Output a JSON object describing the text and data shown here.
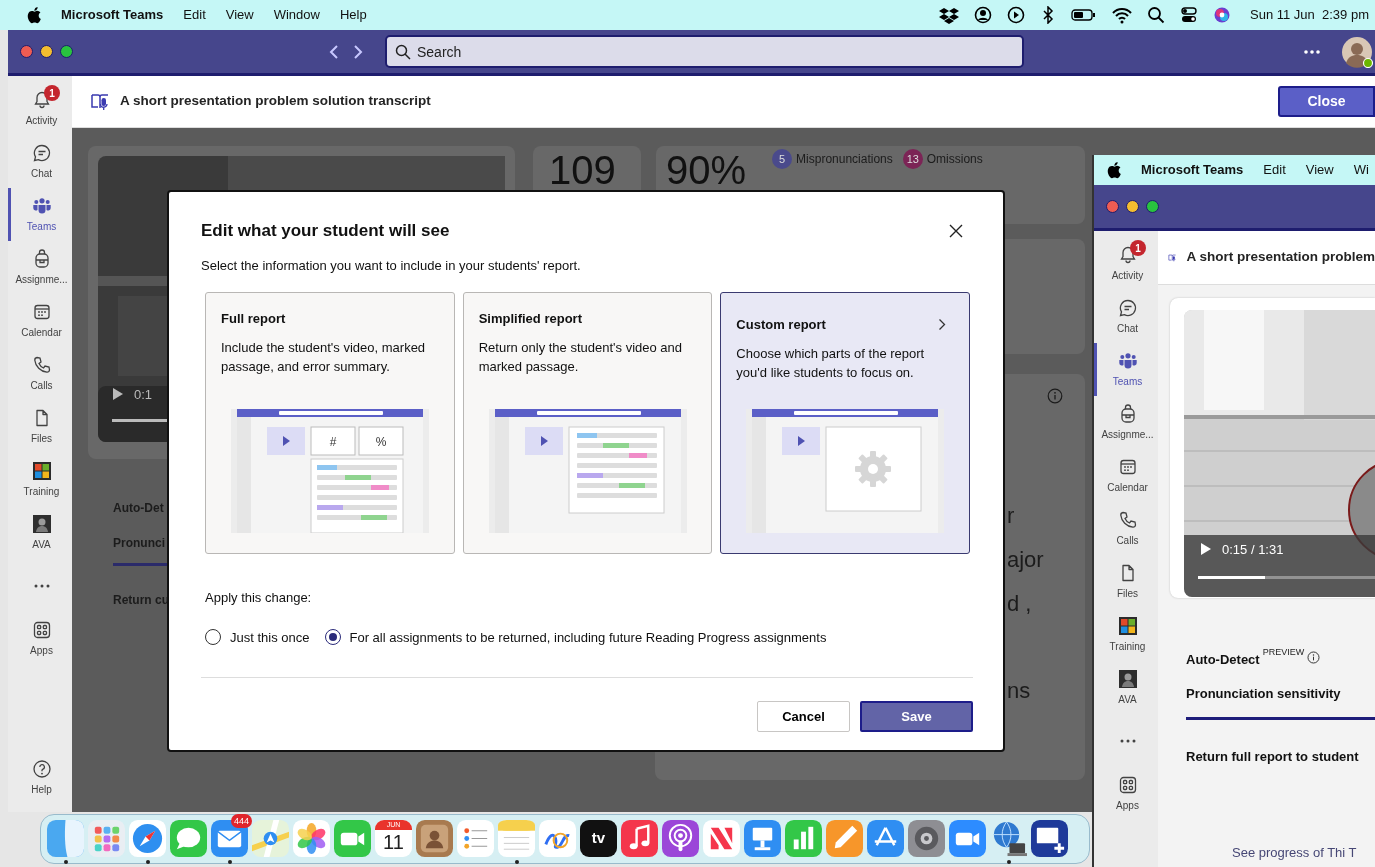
{
  "menu_bar": {
    "app": "Microsoft Teams",
    "items": [
      "Edit",
      "View",
      "Window",
      "Help"
    ],
    "clock": "Sun 11 Jun  2:39 pm"
  },
  "main_window": {
    "search": {
      "placeholder": "Search"
    },
    "rail": [
      {
        "kind": "activity",
        "label": "Activity",
        "selected": false,
        "badge": "1"
      },
      {
        "kind": "chat",
        "label": "Chat",
        "selected": false
      },
      {
        "kind": "teams",
        "label": "Teams",
        "selected": true
      },
      {
        "kind": "assignments",
        "label": "Assignme...",
        "selected": false
      },
      {
        "kind": "calendar",
        "label": "Calendar",
        "selected": false
      },
      {
        "kind": "calls",
        "label": "Calls",
        "selected": false
      },
      {
        "kind": "files",
        "label": "Files",
        "selected": false
      },
      {
        "kind": "training",
        "label": "Training",
        "selected": false
      },
      {
        "kind": "ava",
        "label": "AVA",
        "selected": false
      },
      {
        "kind": "more",
        "selected": false
      },
      {
        "kind": "apps",
        "label": "Apps",
        "selected": false
      },
      {
        "kind": "help",
        "label": "Help",
        "selected": false
      }
    ],
    "header": {
      "title": "A short presentation problem solution transcript",
      "close": "Close"
    },
    "background": {
      "video_time": "0:1",
      "words_count": "109",
      "accuracy": "90%",
      "badges": [
        {
          "count": "5",
          "label": "Mispronunciations",
          "color": "#4a4a8c"
        },
        {
          "count": "13",
          "label": "Omissions",
          "color": "#7c2456"
        }
      ],
      "settings": [
        "Auto-Det",
        "Pronunci",
        "Return cu"
      ],
      "passage_fragments": [
        "r",
        "ajor",
        "d ,",
        "ns"
      ]
    },
    "dialog": {
      "title": "Edit what your student will see",
      "subtitle": "Select the information you want to include in your students' report.",
      "options": [
        {
          "kind": "full",
          "title": "Full report",
          "description": "Include the student's video, marked passage, and error summary.",
          "selected": false,
          "tiles": [
            "#",
            "%"
          ]
        },
        {
          "kind": "simplified",
          "title": "Simplified report",
          "description": "Return only the student's video and marked passage.",
          "selected": false
        },
        {
          "kind": "custom",
          "title": "Custom report",
          "description": "Choose which parts of the report you'd like students to focus on.",
          "selected": true
        }
      ],
      "apply_label": "Apply this change:",
      "scope": [
        {
          "label": "Just this once",
          "selected": false
        },
        {
          "label": "For all assignments to be returned, including future Reading Progress assignments",
          "selected": true
        }
      ],
      "buttons": [
        {
          "kind": "secondary",
          "label": "Cancel"
        },
        {
          "kind": "primary",
          "label": "Save"
        }
      ]
    }
  },
  "second_window": {
    "menu_bar": {
      "app": "Microsoft Teams",
      "items": [
        "Edit",
        "View",
        "Wi"
      ]
    },
    "rail": [
      {
        "kind": "activity",
        "label": "Activity",
        "selected": false,
        "badge": "1"
      },
      {
        "kind": "chat",
        "label": "Chat",
        "selected": false
      },
      {
        "kind": "teams",
        "label": "Teams",
        "selected": true
      },
      {
        "kind": "assignments",
        "label": "Assignme...",
        "selected": false
      },
      {
        "kind": "calendar",
        "label": "Calendar",
        "selected": false
      },
      {
        "kind": "calls",
        "label": "Calls",
        "selected": false
      },
      {
        "kind": "files",
        "label": "Files",
        "selected": false
      },
      {
        "kind": "training",
        "label": "Training",
        "selected": false
      },
      {
        "kind": "ava",
        "label": "AVA",
        "selected": false
      },
      {
        "kind": "more",
        "selected": false
      },
      {
        "kind": "apps",
        "label": "Apps",
        "selected": false
      }
    ],
    "header": {
      "title": "A short presentation problem"
    },
    "video": {
      "time": "0:15 / 1:31",
      "level": 0.38
    },
    "auto_detect": {
      "label": "Auto-Detect",
      "tag": "PREVIEW"
    },
    "sensitivity_label": "Pronunciation sensitivity",
    "return_label": "Return full report to student",
    "link": "See progress of Thi T"
  },
  "dock": [
    {
      "kind": "finder",
      "running": true
    },
    {
      "kind": "launchpad",
      "running": false
    },
    {
      "kind": "safari",
      "running": true
    },
    {
      "kind": "messages",
      "running": false
    },
    {
      "kind": "mail",
      "running": true,
      "badge": "444"
    },
    {
      "kind": "maps",
      "running": false
    },
    {
      "kind": "photos",
      "running": false
    },
    {
      "kind": "facetime",
      "running": false
    },
    {
      "kind": "calendar",
      "running": false,
      "month": "JUN",
      "day": "11"
    },
    {
      "kind": "contacts",
      "running": false
    },
    {
      "kind": "reminders",
      "running": false
    },
    {
      "kind": "notes",
      "running": true
    },
    {
      "kind": "freeform",
      "running": false
    },
    {
      "kind": "tv",
      "running": false,
      "label": "tv"
    },
    {
      "kind": "music",
      "running": false
    },
    {
      "kind": "podcasts",
      "running": false
    },
    {
      "kind": "news",
      "running": false
    },
    {
      "kind": "keynote",
      "running": false
    },
    {
      "kind": "numbers",
      "running": false
    },
    {
      "kind": "pages",
      "running": false
    },
    {
      "kind": "appstore",
      "running": false
    },
    {
      "kind": "settings",
      "running": false
    },
    {
      "kind": "zoom",
      "running": false
    },
    {
      "kind": "network",
      "running": true
    },
    {
      "kind": "screens",
      "running": false
    }
  ]
}
